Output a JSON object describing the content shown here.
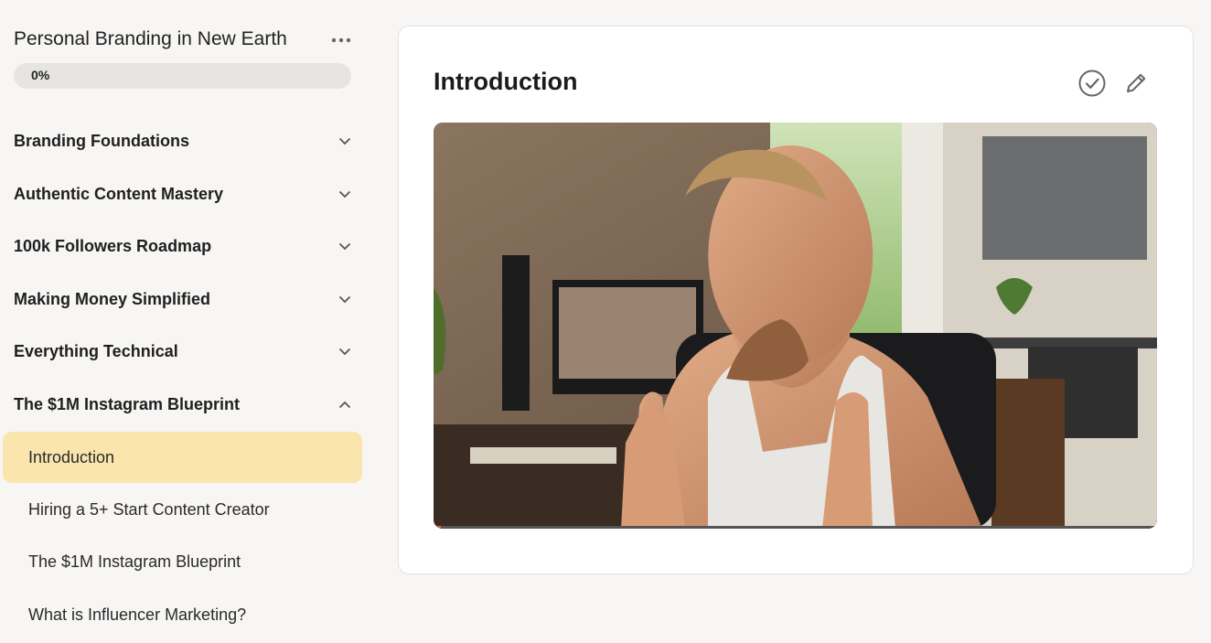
{
  "course": {
    "title": "Personal Branding in New Earth",
    "progress_label": "0%",
    "progress_fraction": 0
  },
  "sections": [
    {
      "label": "Branding Foundations",
      "expanded": false
    },
    {
      "label": "Authentic Content Mastery",
      "expanded": false
    },
    {
      "label": "100k Followers Roadmap",
      "expanded": false
    },
    {
      "label": "Making Money Simplified",
      "expanded": false
    },
    {
      "label": "Everything Technical",
      "expanded": false
    },
    {
      "label": "The $1M Instagram Blueprint",
      "expanded": true
    }
  ],
  "lessons": [
    {
      "label": "Introduction",
      "active": true
    },
    {
      "label": "Hiring a 5+ Start Content Creator",
      "active": false
    },
    {
      "label": "The $1M Instagram Blueprint",
      "active": false
    },
    {
      "label": "What is Influencer Marketing?",
      "active": false
    }
  ],
  "main": {
    "lesson_title": "Introduction",
    "icons": {
      "complete": "check-circle-icon",
      "edit": "pencil-icon",
      "more": "more-horizontal-icon",
      "expand": "chevron-down-icon",
      "collapse": "chevron-up-icon"
    }
  },
  "colors": {
    "background": "#f7f6f4",
    "active_lesson": "#fae5ad",
    "progress_track": "#e6e5e3",
    "panel": "#ffffff"
  }
}
